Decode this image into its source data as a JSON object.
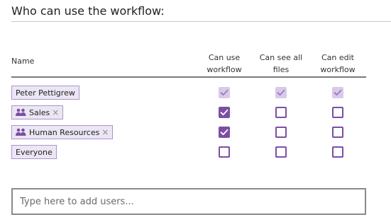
{
  "section_title": "Who can use the workflow:",
  "columns": {
    "name": "Name",
    "can_use_line1": "Can use",
    "can_use_line2": "workflow",
    "can_see_line1": "Can see all",
    "can_see_line2": "files",
    "can_edit_line1": "Can edit",
    "can_edit_line2": "workflow"
  },
  "rows": [
    {
      "label": "Peter Pettigrew",
      "type": "user",
      "removable": false,
      "can_use": "checked-disabled",
      "can_see": "checked-disabled",
      "can_edit": "checked-disabled"
    },
    {
      "label": "Sales",
      "type": "group",
      "removable": true,
      "can_use": "checked",
      "can_see": "unchecked",
      "can_edit": "unchecked"
    },
    {
      "label": "Human Resources",
      "type": "group",
      "removable": true,
      "can_use": "checked",
      "can_see": "unchecked",
      "can_edit": "unchecked"
    },
    {
      "label": "Everyone",
      "type": "user",
      "removable": false,
      "can_use": "unchecked",
      "can_see": "unchecked",
      "can_edit": "unchecked"
    }
  ],
  "remove_glyph": "×",
  "add_users": {
    "placeholder": "Type here to add users...",
    "value": ""
  },
  "colors": {
    "accent": "#7b4fa3",
    "accent_disabled": "#d9c9ea",
    "chip_bg": "#ece6f4",
    "chip_border": "#a996c9"
  },
  "icons": {
    "group": "group-people-icon",
    "check": "checkmark-icon",
    "remove": "close-icon"
  }
}
